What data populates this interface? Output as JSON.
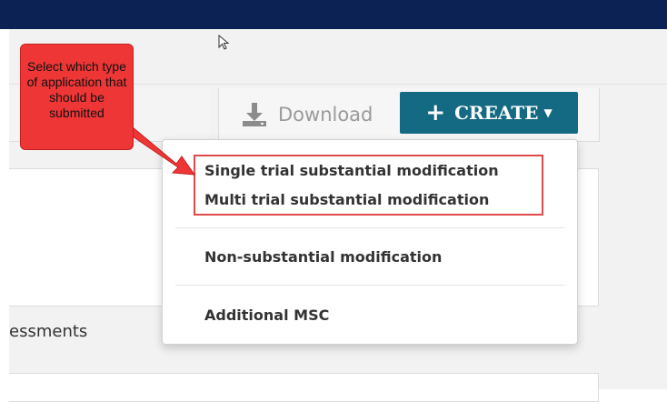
{
  "toolbar": {
    "download_label": "Download",
    "create_label": "CREATE"
  },
  "create_menu": {
    "items": [
      {
        "label": "Single trial substantial modification"
      },
      {
        "label": "Multi trial substantial modification"
      },
      {
        "label": "Non-substantial modification"
      },
      {
        "label": "Additional MSC"
      }
    ]
  },
  "annotation": {
    "callout_text": "Select which type of application that should be submitted"
  },
  "background_text": {
    "assessments_fragment": "essments"
  },
  "icons": {
    "download": "download-icon",
    "plus": "plus-icon",
    "caret": "caret-down-icon",
    "cursor": "mouse-pointer-icon"
  },
  "colors": {
    "top_bar": "#0d2254",
    "create_button": "#146a83",
    "annotation_red": "#ee3636",
    "highlight_border": "#e04a4a"
  }
}
